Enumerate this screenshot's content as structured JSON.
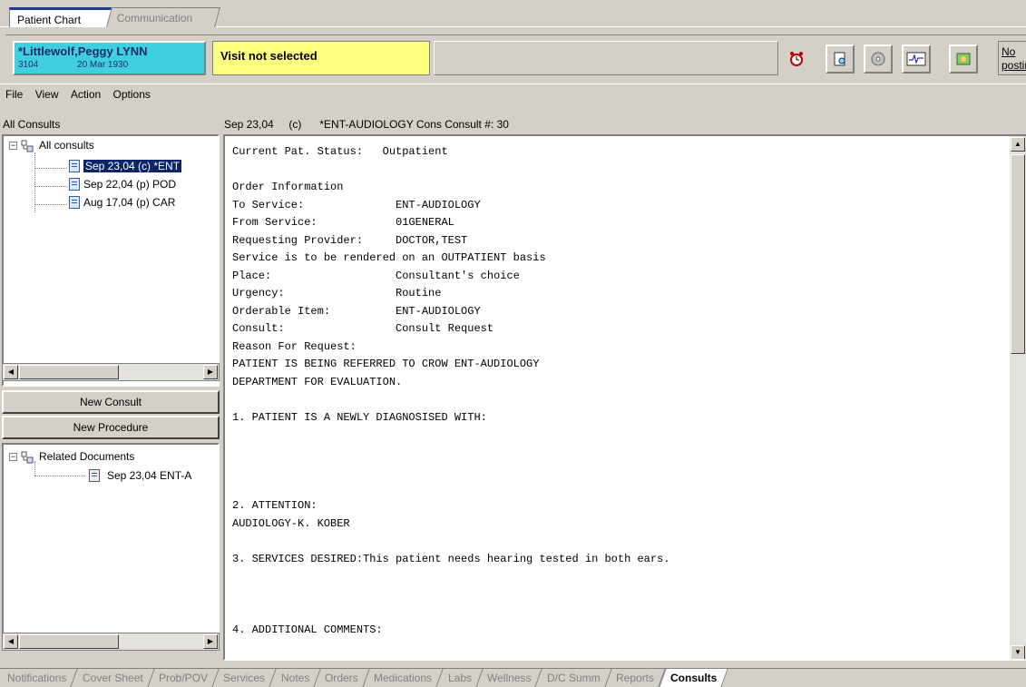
{
  "top_tabs": [
    {
      "label": "Patient Chart"
    },
    {
      "label": "Communication"
    }
  ],
  "header": {
    "patient_name": "*Littlewolf,Peggy LYNN",
    "patient_sub_left": "3104",
    "patient_sub_right": "20 Mar 1930",
    "visit": "Visit not selected",
    "no_posting": "No\npostin"
  },
  "menu": [
    {
      "label": "File",
      "accel": "F"
    },
    {
      "label": "View",
      "accel": "V"
    },
    {
      "label": "Action",
      "accel": "A"
    },
    {
      "label": "Options",
      "accel": "O"
    }
  ],
  "consults": {
    "panel_label": "All Consults",
    "root_label": "All consults",
    "items": [
      {
        "label": "Sep 23,04  (c) *ENT"
      },
      {
        "label": "Sep 22,04  (p) POD"
      },
      {
        "label": "Aug 17,04  (p) CAR"
      }
    ]
  },
  "buttons": {
    "new_consult": "New Consult",
    "new_procedure": "New Procedure"
  },
  "related": {
    "root_label": "Related Documents",
    "items": [
      {
        "label": "Sep 23,04  ENT-A"
      }
    ]
  },
  "detail": {
    "header": "Sep 23,04     (c)      *ENT-AUDIOLOGY Cons Consult #: 30",
    "text": "Current Pat. Status:   Outpatient\n\nOrder Information\nTo Service:              ENT-AUDIOLOGY\nFrom Service:            01GENERAL\nRequesting Provider:     DOCTOR,TEST\nService is to be rendered on an OUTPATIENT basis\nPlace:                   Consultant's choice\nUrgency:                 Routine\nOrderable Item:          ENT-AUDIOLOGY\nConsult:                 Consult Request\nReason For Request:\nPATIENT IS BEING REFERRED TO CROW ENT-AUDIOLOGY\nDEPARTMENT FOR EVALUATION.\n\n1. PATIENT IS A NEWLY DIAGNOSISED WITH:\n\n\n\n\n2. ATTENTION:\nAUDIOLOGY-K. KOBER\n\n3. SERVICES DESIRED:This patient needs hearing tested in both ears.\n\n\n\n4. ADDITIONAL COMMENTS:"
  },
  "bottom_tabs": [
    {
      "label": "Notifications"
    },
    {
      "label": "Cover Sheet"
    },
    {
      "label": "Prob/POV"
    },
    {
      "label": "Services"
    },
    {
      "label": "Notes"
    },
    {
      "label": "Orders"
    },
    {
      "label": "Medications"
    },
    {
      "label": "Labs"
    },
    {
      "label": "Wellness"
    },
    {
      "label": "D/C Summ"
    },
    {
      "label": "Reports"
    },
    {
      "label": "Consults"
    }
  ],
  "colors": {
    "patient_bg": "#3fd0e0",
    "visit_bg": "#ffff80",
    "selection": "#0a246a",
    "window_bg": "#d4d0c8"
  }
}
